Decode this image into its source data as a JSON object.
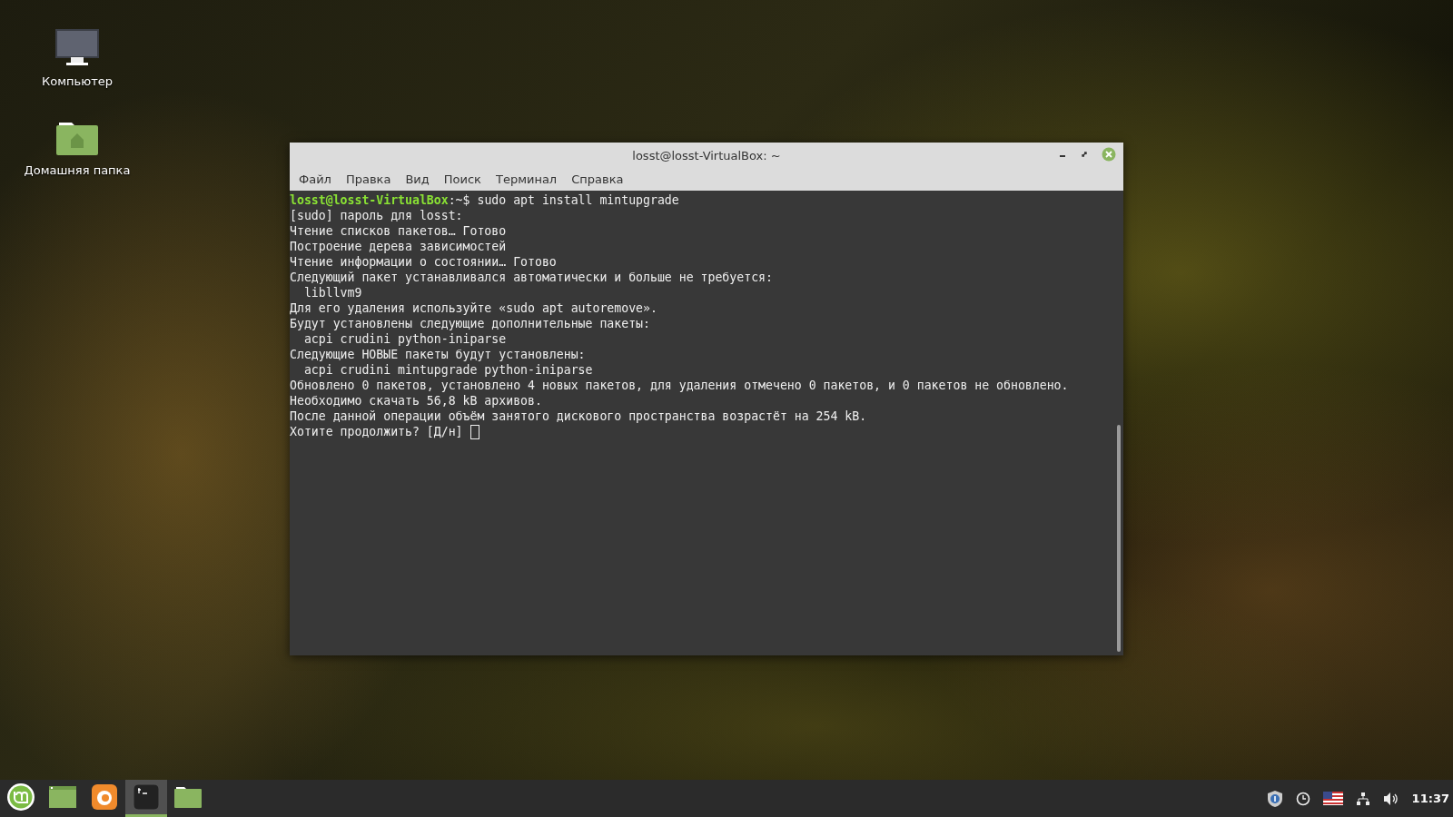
{
  "desktop_icons": [
    {
      "kind": "computer",
      "label": "Компьютер"
    },
    {
      "kind": "home",
      "label": "Домашняя папка"
    }
  ],
  "window": {
    "title": "losst@losst-VirtualBox: ~",
    "menu": [
      "Файл",
      "Правка",
      "Вид",
      "Поиск",
      "Терминал",
      "Справка"
    ]
  },
  "terminal": {
    "prompt": "losst@losst-VirtualBox",
    "prompt_path": ":~$",
    "command": " sudo apt install mintupgrade",
    "lines": [
      "[sudo] пароль для losst:",
      "Чтение списков пакетов… Готово",
      "Построение дерева зависимостей",
      "Чтение информации о состоянии… Готово",
      "Следующий пакет устанавливался автоматически и больше не требуется:",
      "  libllvm9",
      "Для его удаления используйте «sudo apt autoremove».",
      "Будут установлены следующие дополнительные пакеты:",
      "  acpi crudini python-iniparse",
      "Следующие НОВЫЕ пакеты будут установлены:",
      "  acpi crudini mintupgrade python-iniparse",
      "Обновлено 0 пакетов, установлено 4 новых пакетов, для удаления отмечено 0 пакетов, и 0 пакетов не обновлено.",
      "Необходимо скачать 56,8 kB архивов.",
      "После данной операции объём занятого дискового пространства возрастёт на 254 kB.",
      "Хотите продолжить? [Д/н] "
    ]
  },
  "taskbar": {
    "launchers": [
      {
        "kind": "menu",
        "selected": false
      },
      {
        "kind": "desktop",
        "selected": false
      },
      {
        "kind": "browser",
        "selected": false
      },
      {
        "kind": "terminal",
        "selected": true
      },
      {
        "kind": "files",
        "selected": false
      }
    ],
    "clock": "11:37"
  }
}
